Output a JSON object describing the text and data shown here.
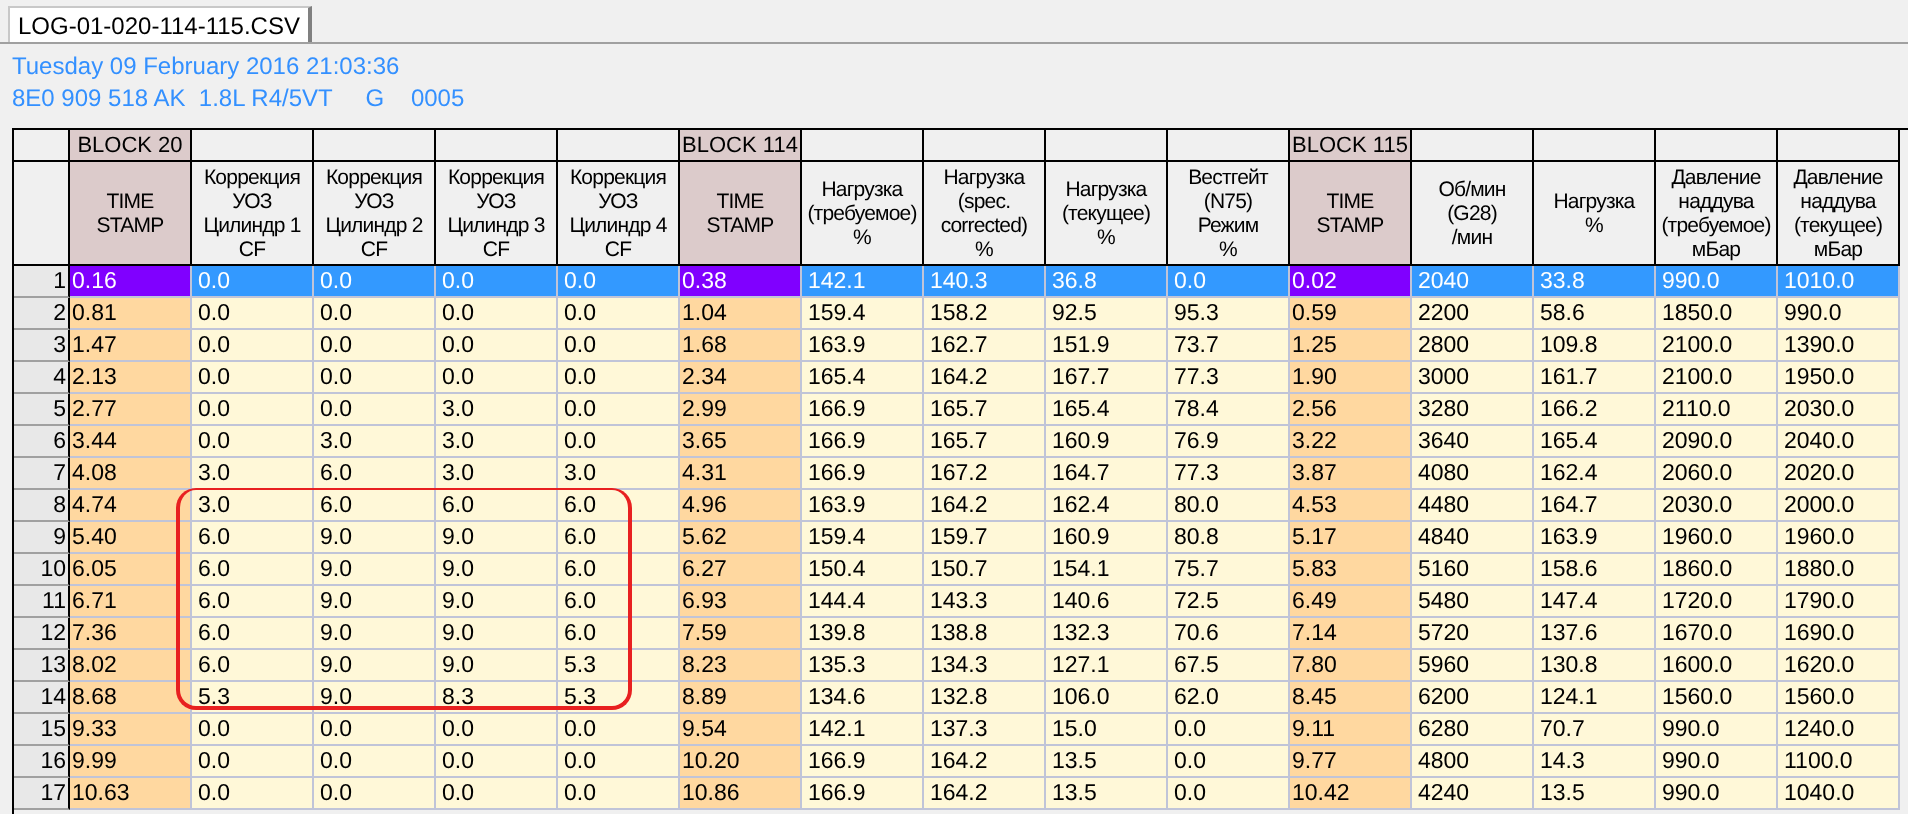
{
  "tab": {
    "label": "LOG-01-020-114-115.CSV",
    "selected": true
  },
  "info": {
    "date": "Tuesday 09 February 2016 21:03:36",
    "vehicle": "8E0 909 518 AK  1.8L R4/5VT     G    0005"
  },
  "table": {
    "columns": [
      {
        "kind": "time",
        "block": "BLOCK 20",
        "header": [
          "TIME",
          "STAMP"
        ]
      },
      {
        "kind": "value",
        "header": [
          "Коррекция",
          "УОЗ",
          "Цилиндр 1",
          "CF"
        ]
      },
      {
        "kind": "value",
        "header": [
          "Коррекция",
          "УОЗ",
          "Цилиндр 2",
          "CF"
        ]
      },
      {
        "kind": "value",
        "header": [
          "Коррекция",
          "УОЗ",
          "Цилиндр 3",
          "CF"
        ]
      },
      {
        "kind": "value",
        "header": [
          "Коррекция",
          "УОЗ",
          "Цилиндр 4",
          "CF"
        ]
      },
      {
        "kind": "time",
        "block": "BLOCK 114",
        "header": [
          "TIME",
          "STAMP"
        ]
      },
      {
        "kind": "value",
        "header": [
          "Нагрузка",
          "(требуемое)",
          "%"
        ]
      },
      {
        "kind": "value",
        "header": [
          "Нагрузка",
          "(spec.",
          "corrected)",
          "%"
        ]
      },
      {
        "kind": "value",
        "header": [
          "Нагрузка",
          "(текущее)",
          "%"
        ]
      },
      {
        "kind": "value",
        "header": [
          "Вестгейт",
          "(N75)",
          "Режим",
          "%"
        ]
      },
      {
        "kind": "time",
        "block": "BLOCK 115",
        "header": [
          "TIME",
          "STAMP"
        ]
      },
      {
        "kind": "value",
        "header": [
          "Об/мин",
          "(G28)",
          "/мин"
        ]
      },
      {
        "kind": "value",
        "header": [
          "Нагрузка",
          "%"
        ]
      },
      {
        "kind": "value",
        "header": [
          "Давление",
          "наддува",
          "(требуемое)",
          "мБар"
        ]
      },
      {
        "kind": "value",
        "header": [
          "Давление",
          "наддува",
          "(текущее)",
          "мБар"
        ]
      }
    ],
    "rows": [
      {
        "number": "1",
        "selected": true,
        "circled": false,
        "cells": [
          "0.16",
          "0.0",
          "0.0",
          "0.0",
          "0.0",
          "0.38",
          "142.1",
          "140.3",
          "36.8",
          "0.0",
          "0.02",
          "2040",
          "33.8",
          "990.0",
          "1010.0"
        ]
      },
      {
        "number": "2",
        "selected": false,
        "circled": false,
        "cells": [
          "0.81",
          "0.0",
          "0.0",
          "0.0",
          "0.0",
          "1.04",
          "159.4",
          "158.2",
          "92.5",
          "95.3",
          "0.59",
          "2200",
          "58.6",
          "1850.0",
          "990.0"
        ]
      },
      {
        "number": "3",
        "selected": false,
        "circled": false,
        "cells": [
          "1.47",
          "0.0",
          "0.0",
          "0.0",
          "0.0",
          "1.68",
          "163.9",
          "162.7",
          "151.9",
          "73.7",
          "1.25",
          "2800",
          "109.8",
          "2100.0",
          "1390.0"
        ]
      },
      {
        "number": "4",
        "selected": false,
        "circled": false,
        "cells": [
          "2.13",
          "0.0",
          "0.0",
          "0.0",
          "0.0",
          "2.34",
          "165.4",
          "164.2",
          "167.7",
          "77.3",
          "1.90",
          "3000",
          "161.7",
          "2100.0",
          "1950.0"
        ]
      },
      {
        "number": "5",
        "selected": false,
        "circled": false,
        "cells": [
          "2.77",
          "0.0",
          "0.0",
          "3.0",
          "0.0",
          "2.99",
          "166.9",
          "165.7",
          "165.4",
          "78.4",
          "2.56",
          "3280",
          "166.2",
          "2110.0",
          "2030.0"
        ]
      },
      {
        "number": "6",
        "selected": false,
        "circled": false,
        "cells": [
          "3.44",
          "0.0",
          "3.0",
          "3.0",
          "0.0",
          "3.65",
          "166.9",
          "165.7",
          "160.9",
          "76.9",
          "3.22",
          "3640",
          "165.4",
          "2090.0",
          "2040.0"
        ]
      },
      {
        "number": "7",
        "selected": false,
        "circled": false,
        "cells": [
          "4.08",
          "3.0",
          "6.0",
          "3.0",
          "3.0",
          "4.31",
          "166.9",
          "167.2",
          "164.7",
          "77.3",
          "3.87",
          "4080",
          "162.4",
          "2060.0",
          "2020.0"
        ]
      },
      {
        "number": "8",
        "selected": false,
        "circled": true,
        "cells": [
          "4.74",
          "3.0",
          "6.0",
          "6.0",
          "6.0",
          "4.96",
          "163.9",
          "164.2",
          "162.4",
          "80.0",
          "4.53",
          "4480",
          "164.7",
          "2030.0",
          "2000.0"
        ]
      },
      {
        "number": "9",
        "selected": false,
        "circled": true,
        "cells": [
          "5.40",
          "6.0",
          "9.0",
          "9.0",
          "6.0",
          "5.62",
          "159.4",
          "159.7",
          "160.9",
          "80.8",
          "5.17",
          "4840",
          "163.9",
          "1960.0",
          "1960.0"
        ]
      },
      {
        "number": "10",
        "selected": false,
        "circled": true,
        "cells": [
          "6.05",
          "6.0",
          "9.0",
          "9.0",
          "6.0",
          "6.27",
          "150.4",
          "150.7",
          "154.1",
          "75.7",
          "5.83",
          "5160",
          "158.6",
          "1860.0",
          "1880.0"
        ]
      },
      {
        "number": "11",
        "selected": false,
        "circled": true,
        "cells": [
          "6.71",
          "6.0",
          "9.0",
          "9.0",
          "6.0",
          "6.93",
          "144.4",
          "143.3",
          "140.6",
          "72.5",
          "6.49",
          "5480",
          "147.4",
          "1720.0",
          "1790.0"
        ]
      },
      {
        "number": "12",
        "selected": false,
        "circled": true,
        "cells": [
          "7.36",
          "6.0",
          "9.0",
          "9.0",
          "6.0",
          "7.59",
          "139.8",
          "138.8",
          "132.3",
          "70.6",
          "7.14",
          "5720",
          "137.6",
          "1670.0",
          "1690.0"
        ]
      },
      {
        "number": "13",
        "selected": false,
        "circled": true,
        "cells": [
          "8.02",
          "6.0",
          "9.0",
          "9.0",
          "5.3",
          "8.23",
          "135.3",
          "134.3",
          "127.1",
          "67.5",
          "7.80",
          "5960",
          "130.8",
          "1600.0",
          "1620.0"
        ]
      },
      {
        "number": "14",
        "selected": false,
        "circled": true,
        "cells": [
          "8.68",
          "5.3",
          "9.0",
          "8.3",
          "5.3",
          "8.89",
          "134.6",
          "132.8",
          "106.0",
          "62.0",
          "8.45",
          "6200",
          "124.1",
          "1560.0",
          "1560.0"
        ]
      },
      {
        "number": "15",
        "selected": false,
        "circled": false,
        "cells": [
          "9.33",
          "0.0",
          "0.0",
          "0.0",
          "0.0",
          "9.54",
          "142.1",
          "137.3",
          "15.0",
          "0.0",
          "9.11",
          "6280",
          "70.7",
          "990.0",
          "1240.0"
        ]
      },
      {
        "number": "16",
        "selected": false,
        "circled": false,
        "cells": [
          "9.99",
          "0.0",
          "0.0",
          "0.0",
          "0.0",
          "10.20",
          "166.9",
          "164.2",
          "13.5",
          "0.0",
          "9.77",
          "4800",
          "14.3",
          "990.0",
          "1100.0"
        ]
      },
      {
        "number": "17",
        "selected": false,
        "circled": false,
        "cells": [
          "10.63",
          "0.0",
          "0.0",
          "0.0",
          "0.0",
          "10.86",
          "166.9",
          "164.2",
          "13.5",
          "0.0",
          "10.42",
          "4240",
          "13.5",
          "990.0",
          "1040.0"
        ]
      }
    ]
  }
}
